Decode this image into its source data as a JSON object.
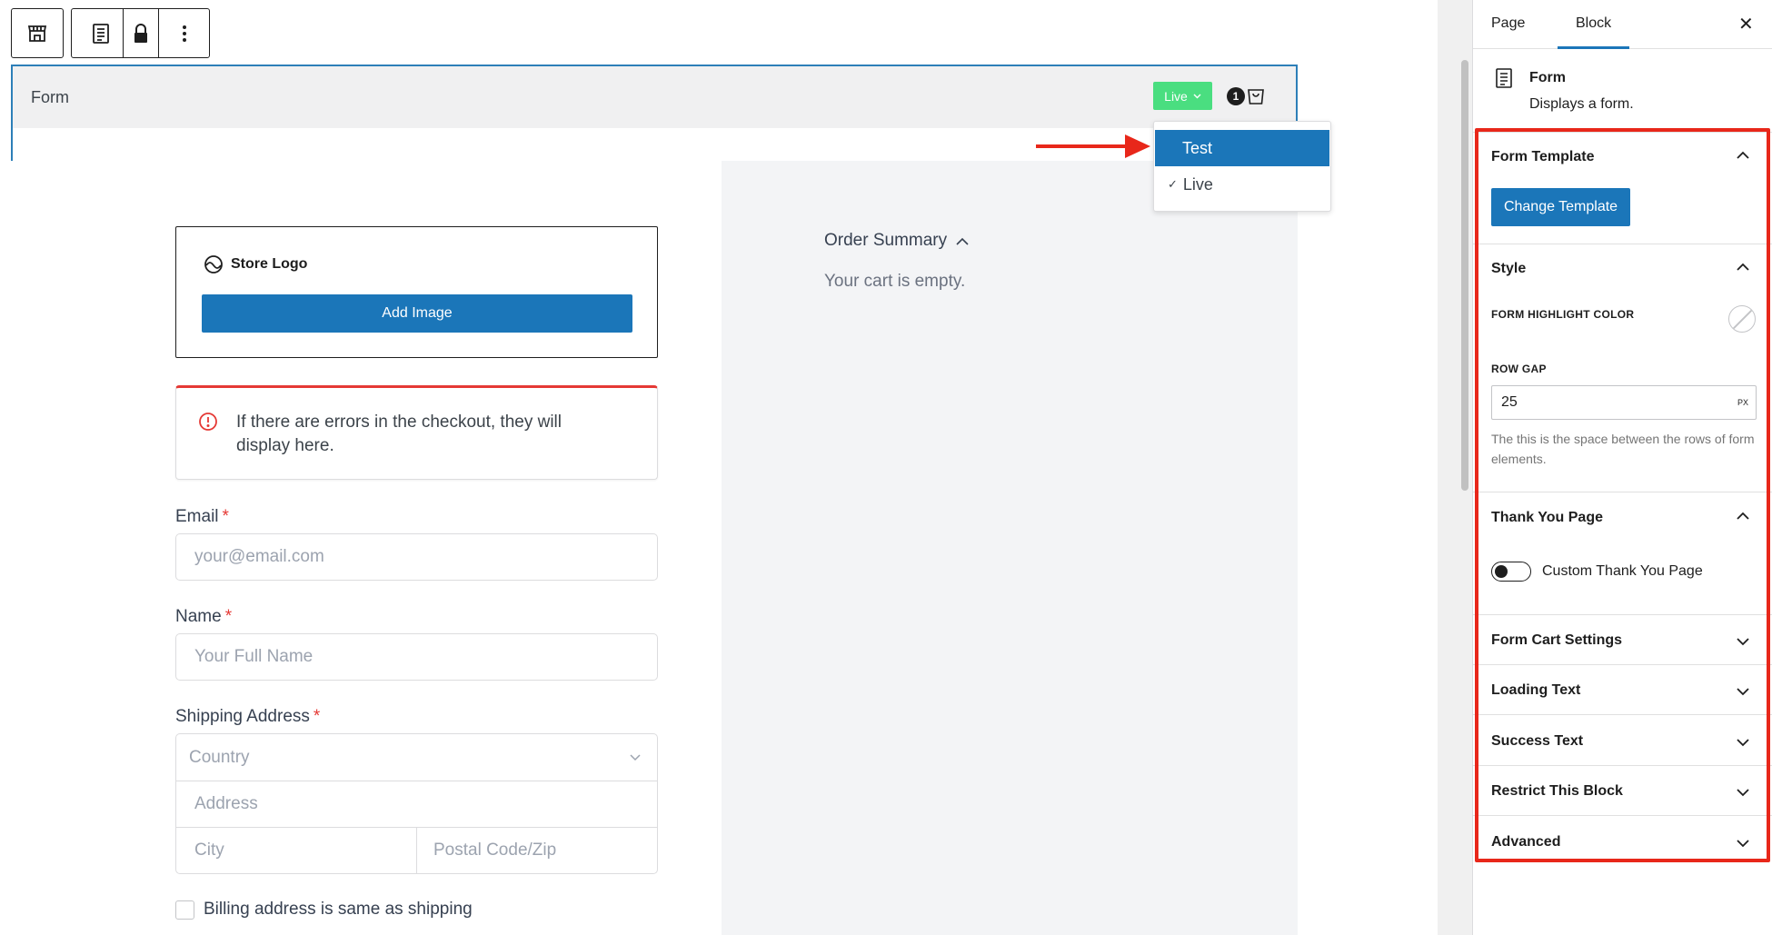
{
  "toolbar": {
    "icons": [
      "store-icon",
      "form-icon",
      "lock-icon",
      "more-vertical-icon"
    ]
  },
  "form_block": {
    "title": "Form",
    "mode_badge": "Live",
    "cart_count": "1"
  },
  "mode_dropdown": {
    "options": [
      {
        "label": "Test",
        "highlighted": true,
        "checked": false
      },
      {
        "label": "Live",
        "highlighted": false,
        "checked": true
      }
    ],
    "check_mark": "✓"
  },
  "checkout_form": {
    "logo_label": "Store Logo",
    "add_image_label": "Add Image",
    "error_message": "If there are errors in the checkout, they will display here.",
    "email": {
      "label": "Email",
      "required_mark": "*",
      "placeholder": "your@email.com"
    },
    "name": {
      "label": "Name",
      "required_mark": "*",
      "placeholder": "Your Full Name"
    },
    "shipping": {
      "label": "Shipping Address",
      "required_mark": "*",
      "country_placeholder": "Country",
      "address_placeholder": "Address",
      "city_placeholder": "City",
      "postal_placeholder": "Postal Code/Zip"
    },
    "billing_same_label": "Billing address is same as shipping"
  },
  "order_summary": {
    "title": "Order Summary",
    "empty_text": "Your cart is empty."
  },
  "sidebar": {
    "tabs": {
      "page": "Page",
      "block": "Block"
    },
    "close_symbol": "✕",
    "block_name": "Form",
    "block_description": "Displays a form.",
    "sections": {
      "form_template": {
        "title": "Form Template",
        "button": "Change Template"
      },
      "style": {
        "title": "Style",
        "highlight_color_label": "FORM HIGHLIGHT COLOR",
        "row_gap_label": "ROW GAP",
        "row_gap_value": "25",
        "row_gap_unit": "PX",
        "row_gap_help": "The this is the space between the rows of form elements."
      },
      "thank_you": {
        "title": "Thank You Page",
        "toggle_label": "Custom Thank You Page",
        "toggle_on": false
      },
      "cart_settings": "Form Cart Settings",
      "loading_text": "Loading Text",
      "success_text": "Success Text",
      "restrict_block": "Restrict This Block",
      "advanced": "Advanced"
    }
  },
  "colors": {
    "accent": "#1b76b9",
    "live_badge": "#4ade80",
    "annotation_red": "#e8271a",
    "error_red": "#e53935"
  }
}
